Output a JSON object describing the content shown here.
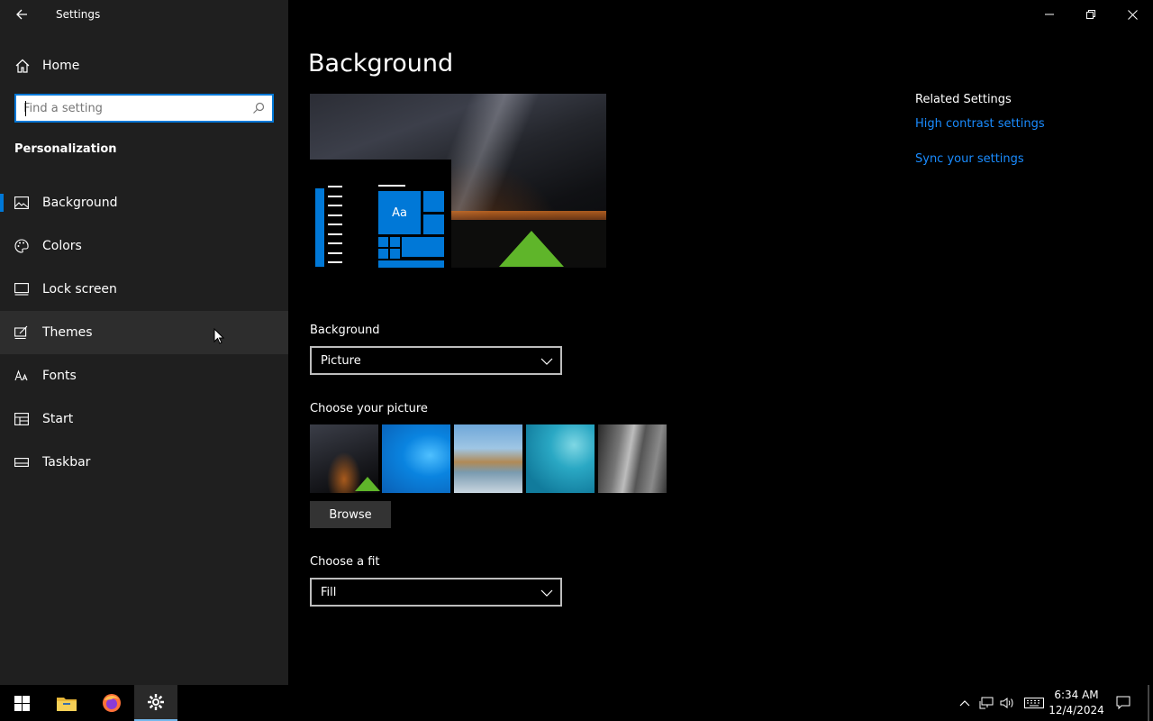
{
  "window": {
    "title": "Settings"
  },
  "sidebar": {
    "home_label": "Home",
    "search_placeholder": "Find a setting",
    "section_title": "Personalization",
    "items": [
      {
        "label": "Background",
        "icon": "picture-icon",
        "selected": true
      },
      {
        "label": "Colors",
        "icon": "palette-icon"
      },
      {
        "label": "Lock screen",
        "icon": "lock-screen-icon"
      },
      {
        "label": "Themes",
        "icon": "themes-icon",
        "hover": true
      },
      {
        "label": "Fonts",
        "icon": "fonts-icon"
      },
      {
        "label": "Start",
        "icon": "start-icon"
      },
      {
        "label": "Taskbar",
        "icon": "taskbar-icon"
      }
    ]
  },
  "main": {
    "page_title": "Background",
    "preview_tile_text": "Aa",
    "background_label": "Background",
    "background_value": "Picture",
    "choose_picture_label": "Choose your picture",
    "browse_label": "Browse",
    "fit_label": "Choose a fit",
    "fit_value": "Fill"
  },
  "related": {
    "heading": "Related Settings",
    "links": [
      "High contrast settings",
      "Sync your settings"
    ]
  },
  "taskbar": {
    "time": "6:34 AM",
    "date": "12/4/2024",
    "pinned": [
      "windows-start-icon",
      "file-explorer-icon",
      "firefox-icon",
      "settings-gear-icon"
    ]
  },
  "colors": {
    "accent": "#0078d7",
    "link": "#1a8cff",
    "sidebar_bg": "#1f1f1f",
    "main_bg": "#000000"
  }
}
